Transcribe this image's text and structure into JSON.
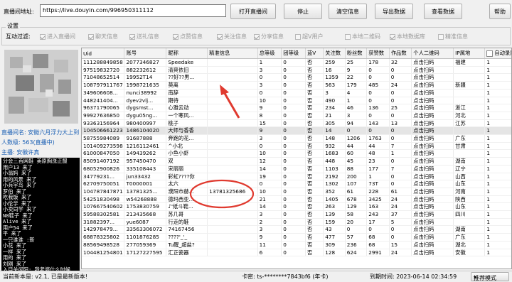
{
  "toolbar": {
    "url_label": "直播间地址:",
    "url_value": "https://live.douyin.com/996950311112",
    "open_btn": "打开直播间",
    "stop_btn": "停止",
    "clear_btn": "清空信息",
    "export_btn": "导出数据",
    "view_btn": "查看数据",
    "help_btn": "帮助"
  },
  "settings": {
    "group_title": "设置",
    "filter_label": "互动过滤:",
    "options": [
      {
        "label": "进入直播间",
        "checked": true
      },
      {
        "label": "聊天信息",
        "checked": true
      },
      {
        "label": "送礼信息",
        "checked": true
      },
      {
        "label": "点赞信息",
        "checked": true
      },
      {
        "label": "关注信息",
        "checked": true
      },
      {
        "label": "分享信息",
        "checked": true
      },
      {
        "label": "超V用户",
        "checked": false
      },
      {
        "label": "本地二维码",
        "checked": false
      },
      {
        "label": "本地数据库",
        "checked": true
      },
      {
        "label": "精准信息",
        "checked": false
      }
    ]
  },
  "left": {
    "room_name": "直播间名: 安徽六月浮力大上到",
    "viewers": "人数级: 563(直播中)",
    "host": "主播: 安徽许真",
    "chat_lines": [
      "分会三首网鞋 美原胸涨正服",
      "用户13 来了",
      "小翁妈 来了",
      "用的风景 来了",
      "小兵宇鸟 来了",
      "罗伯 来了",
      "吃我饭 来了",
      "小伦学 来了",
      "小卖同学 来了",
      "N8鞋子 来了",
      "Alive 来了",
      "用户54 来了",
      "平 来了",
      "一只谁谁 :新",
      "小花 来了",
      "一样 来了",
      "用的 来了",
      "刘刚 来了",
      "入目关闲阳: 我老婆什么时候",
      "开往[沉]"
    ]
  },
  "table": {
    "columns": [
      "Uid",
      "账号",
      "昵称",
      "精准信息",
      "总等级",
      "团等级",
      "蓝V",
      "关注数",
      "粉丝数",
      "获赞数",
      "作品数",
      "个人二维码",
      "IP属地",
      "自动录屏"
    ],
    "rows": [
      [
        "111288849858",
        "2077346827",
        "Speedake",
        "",
        "1",
        "0",
        "否",
        "259",
        "25",
        "178",
        "32",
        "点击扫码",
        "福建",
        "1"
      ],
      [
        "97519832720",
        "882232612",
        "清爽依旧",
        "",
        "3",
        "0",
        "否",
        "16",
        "9",
        "0",
        "0",
        "点击扫码",
        "",
        "1"
      ],
      [
        "71048652514",
        "19952T14",
        "??好??男...",
        "",
        "0",
        "0",
        "否",
        "1359",
        "22",
        "0",
        "0",
        "点击扫码",
        "",
        "1"
      ],
      [
        "108797911767",
        "1998721635",
        "莫离",
        "",
        "3",
        "0",
        "否",
        "563",
        "179",
        "485",
        "24",
        "点击扫码",
        "新疆",
        "1"
      ],
      [
        "349606608...",
        "nunci38992",
        "南辞",
        "",
        "0",
        "0",
        "否",
        "3",
        "4",
        "0",
        "0",
        "点击扫码",
        "",
        "1"
      ],
      [
        "448241404...",
        "dyev2vlj...",
        "期待",
        "",
        "10",
        "0",
        "否",
        "490",
        "1",
        "0",
        "0",
        "点击扫码",
        "",
        "1"
      ],
      [
        "96371790065",
        "dygsmst...",
        "心雅云动",
        "",
        "9",
        "0",
        "否",
        "234",
        "46",
        "136",
        "25",
        "点击扫码",
        "浙江",
        "1"
      ],
      [
        "99927636850",
        "dygu05ng...",
        "一个寒风...",
        "",
        "8",
        "0",
        "否",
        "21",
        "3",
        "0",
        "0",
        "点击扫码",
        "河北",
        "1"
      ],
      [
        "93363156964",
        "980400997",
        "桃子",
        "",
        "15",
        "0",
        "否",
        "305",
        "94",
        "143",
        "13",
        "点击扫码",
        "江苏",
        "1"
      ],
      [
        "104506661223",
        "1486104020",
        "大师与香香",
        "",
        "9",
        "0",
        "否",
        "14",
        "0",
        "0",
        "0",
        "点击扫码",
        "",
        "1"
      ],
      [
        "58755984089",
        "91687888",
        "奔跑的花...",
        "",
        "3",
        "0",
        "否",
        "148",
        "1206",
        "1763",
        "0",
        "点击扫码",
        "广东",
        "1"
      ],
      [
        "101409273598",
        "1216112461",
        "^小北",
        "",
        "0",
        "0",
        "否",
        "932",
        "44",
        "44",
        "7",
        "点击扫码",
        "甘肃",
        "1"
      ],
      [
        "61000847050",
        "149439262",
        "小鱼小虾",
        "",
        "10",
        "0",
        "否",
        "1683",
        "60",
        "48",
        "1",
        "点击扫码",
        "",
        "1"
      ],
      [
        "85091407192",
        "957450470",
        "双",
        "",
        "12",
        "0",
        "否",
        "448",
        "45",
        "23",
        "0",
        "点击扫码",
        "湖南",
        "1"
      ],
      [
        "68052900826",
        "335108443",
        "宋丽丽",
        "",
        "14",
        "0",
        "否",
        "1103",
        "88",
        "177",
        "7",
        "点击扫码",
        "辽宁",
        "1"
      ],
      [
        "34779231...",
        "jun33432",
        "彩虹????你",
        "",
        "19",
        "0",
        "否",
        "2192",
        "200",
        "1",
        "0",
        "点击扫码",
        "山西",
        "1"
      ],
      [
        "62709750051",
        "T0000001",
        "太六",
        "",
        "0",
        "0",
        "否",
        "1302",
        "107",
        "73T",
        "0",
        "点击扫码",
        "山东",
        "1"
      ],
      [
        "104787847871",
        "13781325...",
        "濮阳市赫...",
        "13781325686",
        "10",
        "0",
        "否",
        "352",
        "61",
        "228",
        "61",
        "点击扫码",
        "河南",
        "1"
      ],
      [
        "54251830498",
        "w54268888",
        "德玛西亚...",
        "",
        "21",
        "0",
        "否",
        "1405",
        "678",
        "3425",
        "24",
        "点击扫码",
        "陕西",
        "1"
      ],
      [
        "107667540602",
        "1753830759",
        "♪'纸斗鞋...",
        "",
        "14",
        "0",
        "否",
        "263",
        "129",
        "163",
        "24",
        "点击扫码",
        "山东",
        "1"
      ],
      [
        "59588302581",
        "213435668",
        "苏几哥",
        "",
        "3",
        "0",
        "否",
        "139",
        "58",
        "243",
        "37",
        "点击扫码",
        "四川",
        "1"
      ],
      [
        "31882397...",
        "yue6087",
        "行走的鞋",
        "",
        "2",
        "0",
        "否",
        "159",
        "20",
        "17",
        "5",
        "点击扫码",
        "",
        "1"
      ],
      [
        "142978479...",
        "33563306072",
        "74167456",
        "",
        "3",
        "0",
        "否",
        "43",
        "0",
        "0",
        "0",
        "点击扫码",
        "湖南",
        "1"
      ],
      [
        "68878325802",
        "1101876285",
        "????'_'_",
        "",
        "9",
        "0",
        "否",
        "477",
        "57",
        "68",
        "0",
        "点击扫码",
        "广东",
        "1"
      ],
      [
        "88569498528",
        "277059369",
        "Tu醒_超盐?",
        "",
        "11",
        "0",
        "否",
        "309",
        "236",
        "68",
        "15",
        "点击扫码",
        "湖北",
        "1"
      ],
      [
        "104481254801",
        "17127227595",
        "汇正瓷器",
        "",
        "6",
        "0",
        "否",
        "128",
        "624",
        "2991",
        "24",
        "点击扫码",
        "安徽",
        "1"
      ]
    ]
  },
  "status": {
    "version": "当前新本是: v2.1, 已是最新版本!",
    "card": "卡密: ts-********7843bf6 (年卡)",
    "expire": "到期时间: 2023-06-14 02:34:59",
    "mode_label": "推荐模式"
  },
  "annotation": {
    "arrow_color": "#e03a2f"
  }
}
